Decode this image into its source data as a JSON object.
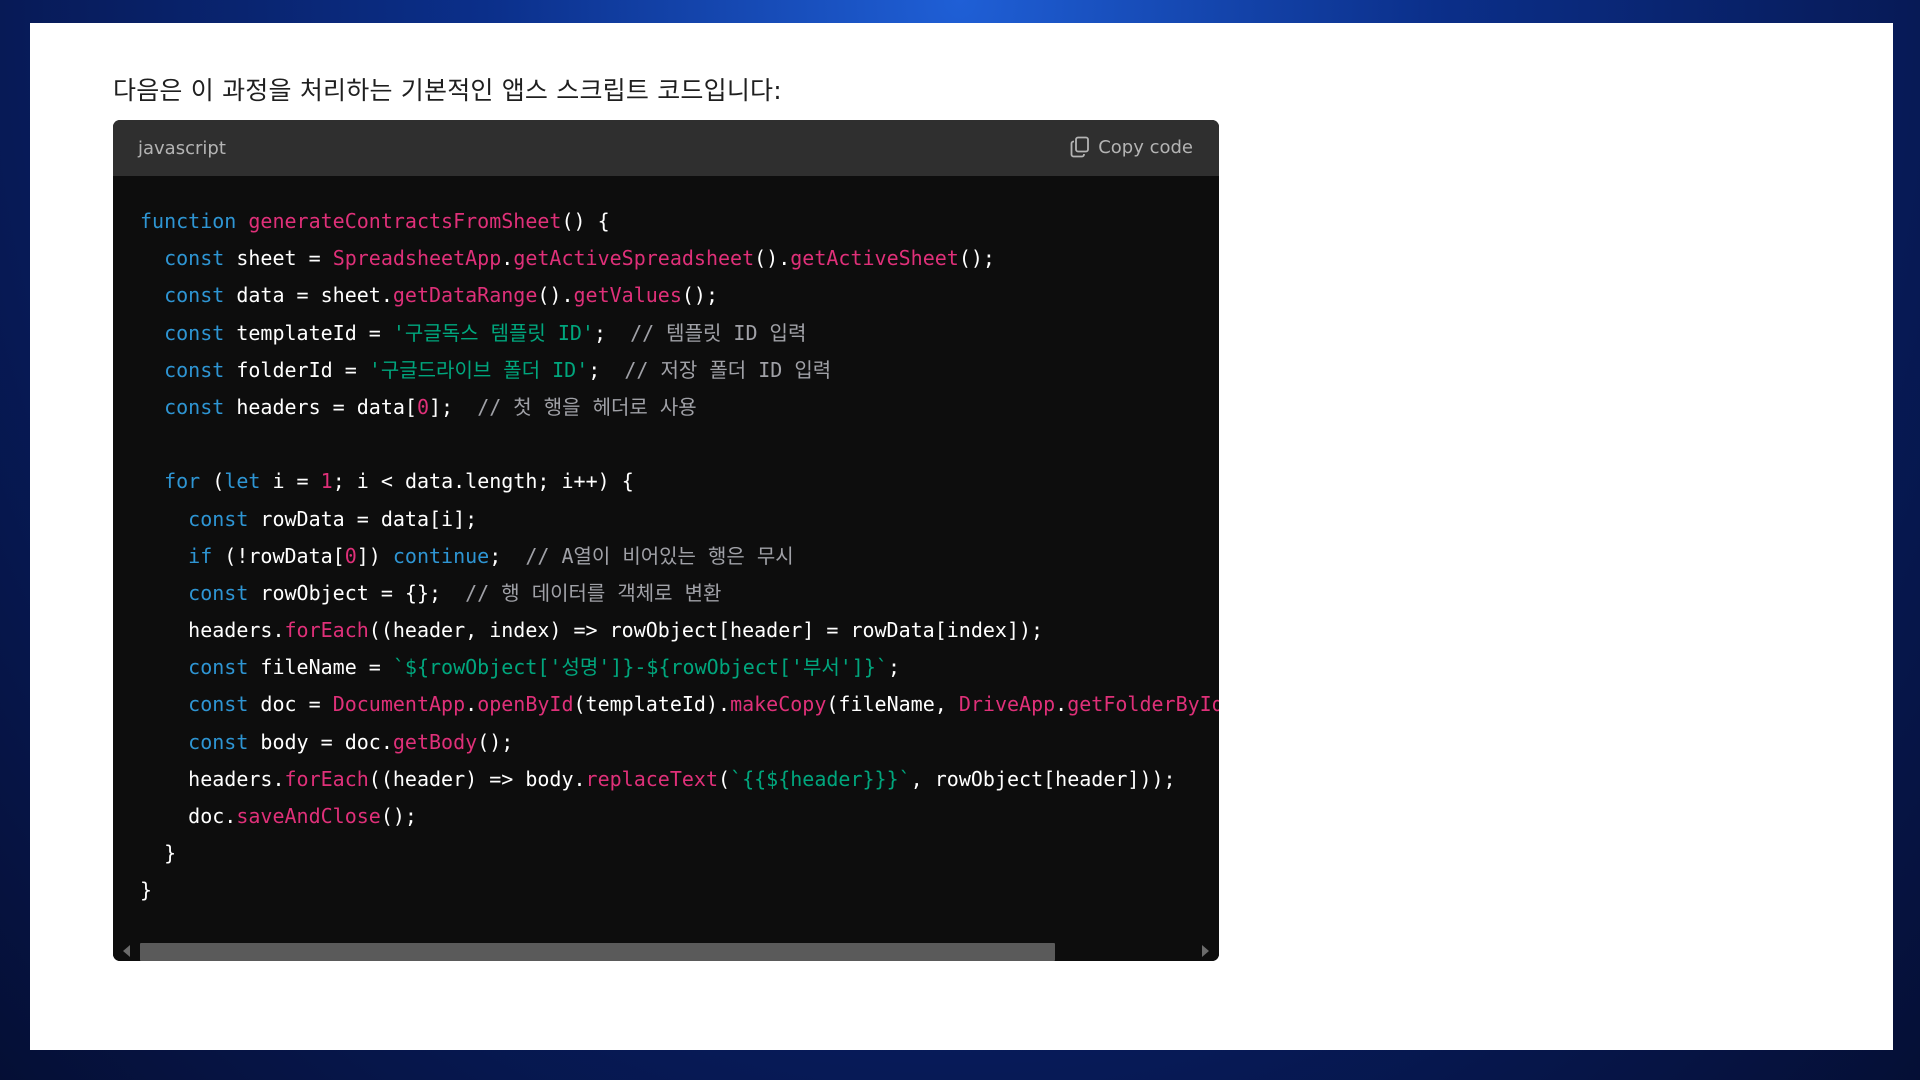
{
  "intro_text": "다음은 이 과정을 처리하는 기본적인 앱스 스크립트 코드입니다:",
  "code_block": {
    "language": "javascript",
    "copy_label": "Copy code",
    "colors": {
      "keyword": "#2e95d3",
      "function": "#df3079",
      "string": "#00a67d",
      "comment": "#a0a1a7",
      "plain": "#ffffff"
    },
    "lines": [
      [
        [
          "kw",
          "function"
        ],
        [
          "p",
          " "
        ],
        [
          "fn",
          "generateContractsFromSheet"
        ],
        [
          "p",
          "() {"
        ]
      ],
      [
        [
          "p",
          "  "
        ],
        [
          "kw",
          "const"
        ],
        [
          "p",
          " sheet = "
        ],
        [
          "fn",
          "SpreadsheetApp"
        ],
        [
          "p",
          "."
        ],
        [
          "fn",
          "getActiveSpreadsheet"
        ],
        [
          "p",
          "()."
        ],
        [
          "fn",
          "getActiveSheet"
        ],
        [
          "p",
          "();"
        ]
      ],
      [
        [
          "p",
          "  "
        ],
        [
          "kw",
          "const"
        ],
        [
          "p",
          " data = sheet."
        ],
        [
          "fn",
          "getDataRange"
        ],
        [
          "p",
          "()."
        ],
        [
          "fn",
          "getValues"
        ],
        [
          "p",
          "();"
        ]
      ],
      [
        [
          "p",
          "  "
        ],
        [
          "kw",
          "const"
        ],
        [
          "p",
          " templateId = "
        ],
        [
          "str",
          "'구글독스 템플릿 ID'"
        ],
        [
          "p",
          ";  "
        ],
        [
          "cm",
          "// 템플릿 ID 입력"
        ]
      ],
      [
        [
          "p",
          "  "
        ],
        [
          "kw",
          "const"
        ],
        [
          "p",
          " folderId = "
        ],
        [
          "str",
          "'구글드라이브 폴더 ID'"
        ],
        [
          "p",
          ";  "
        ],
        [
          "cm",
          "// 저장 폴더 ID 입력"
        ]
      ],
      [
        [
          "p",
          "  "
        ],
        [
          "kw",
          "const"
        ],
        [
          "p",
          " headers = data["
        ],
        [
          "num",
          "0"
        ],
        [
          "p",
          "];  "
        ],
        [
          "cm",
          "// 첫 행을 헤더로 사용"
        ]
      ],
      [
        [
          "p",
          ""
        ]
      ],
      [
        [
          "p",
          "  "
        ],
        [
          "kw",
          "for"
        ],
        [
          "p",
          " ("
        ],
        [
          "kw",
          "let"
        ],
        [
          "p",
          " i = "
        ],
        [
          "num",
          "1"
        ],
        [
          "p",
          "; i < data.length; i++) {"
        ]
      ],
      [
        [
          "p",
          "    "
        ],
        [
          "kw",
          "const"
        ],
        [
          "p",
          " rowData = data[i];"
        ]
      ],
      [
        [
          "p",
          "    "
        ],
        [
          "kw",
          "if"
        ],
        [
          "p",
          " (!rowData["
        ],
        [
          "num",
          "0"
        ],
        [
          "p",
          "]) "
        ],
        [
          "kw",
          "continue"
        ],
        [
          "p",
          ";  "
        ],
        [
          "cm",
          "// A열이 비어있는 행은 무시"
        ]
      ],
      [
        [
          "p",
          "    "
        ],
        [
          "kw",
          "const"
        ],
        [
          "p",
          " rowObject = {};  "
        ],
        [
          "cm",
          "// 행 데이터를 객체로 변환"
        ]
      ],
      [
        [
          "p",
          "    headers."
        ],
        [
          "fn",
          "forEach"
        ],
        [
          "p",
          "((header, index) => rowObject[header] = rowData[index]);"
        ]
      ],
      [
        [
          "p",
          "    "
        ],
        [
          "kw",
          "const"
        ],
        [
          "p",
          " fileName = "
        ],
        [
          "str",
          "`${rowObject['성명']}-${rowObject['부서']}`"
        ],
        [
          "p",
          ";"
        ]
      ],
      [
        [
          "p",
          "    "
        ],
        [
          "kw",
          "const"
        ],
        [
          "p",
          " doc = "
        ],
        [
          "fn",
          "DocumentApp"
        ],
        [
          "p",
          "."
        ],
        [
          "fn",
          "openById"
        ],
        [
          "p",
          "(templateId)."
        ],
        [
          "fn",
          "makeCopy"
        ],
        [
          "p",
          "(fileName, "
        ],
        [
          "fn",
          "DriveApp"
        ],
        [
          "p",
          "."
        ],
        [
          "fn",
          "getFolderById"
        ]
      ],
      [
        [
          "p",
          "    "
        ],
        [
          "kw",
          "const"
        ],
        [
          "p",
          " body = doc."
        ],
        [
          "fn",
          "getBody"
        ],
        [
          "p",
          "();"
        ]
      ],
      [
        [
          "p",
          "    headers."
        ],
        [
          "fn",
          "forEach"
        ],
        [
          "p",
          "((header) => body."
        ],
        [
          "fn",
          "replaceText"
        ],
        [
          "p",
          "("
        ],
        [
          "str",
          "`{{${header}}}`"
        ],
        [
          "p",
          ", rowObject[header]));"
        ]
      ],
      [
        [
          "p",
          "    doc."
        ],
        [
          "fn",
          "saveAndClose"
        ],
        [
          "p",
          "();"
        ]
      ],
      [
        [
          "p",
          "  }"
        ]
      ],
      [
        [
          "p",
          "}"
        ]
      ]
    ]
  }
}
